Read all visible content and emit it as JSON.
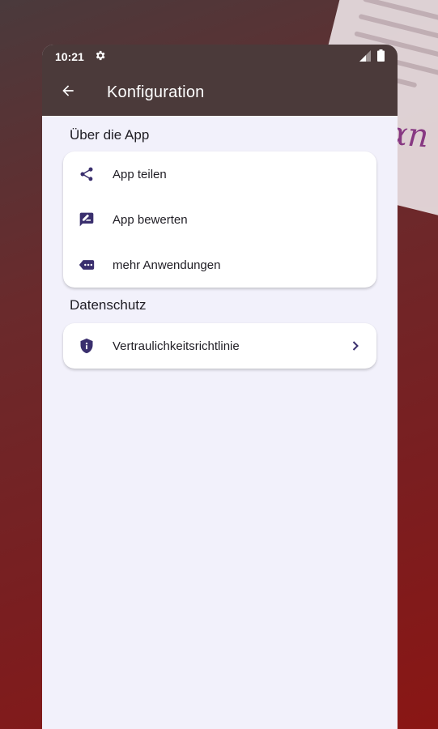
{
  "status_bar": {
    "time": "10:21",
    "icons": [
      "settings-icon",
      "signal-icon",
      "battery-icon"
    ]
  },
  "app_bar": {
    "title": "Konfiguration",
    "back_icon": "arrow-back-icon"
  },
  "sections": [
    {
      "title": "Über die App",
      "items": [
        {
          "label": "App teilen",
          "icon": "share-icon"
        },
        {
          "label": "App bewerten",
          "icon": "rate-review-icon"
        },
        {
          "label": "mehr Anwendungen",
          "icon": "more-apps-icon"
        }
      ]
    },
    {
      "title": "Datenschutz",
      "items": [
        {
          "label": "Vertraulichkeitsrichtlinie",
          "icon": "shield-icon",
          "trailing_icon": "chevron-right-icon"
        }
      ]
    }
  ],
  "colors": {
    "app_bar": "#4b3a3a",
    "content_background": "#f2f1fb",
    "icon": "#3a2f6e",
    "text": "#1f1d24"
  }
}
